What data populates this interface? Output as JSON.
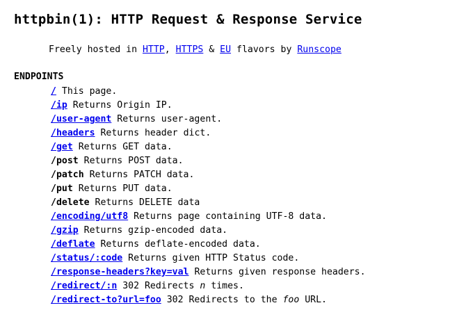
{
  "header": {
    "title": "httpbin(1): HTTP Request & Response Service"
  },
  "tagline": {
    "prefix": "Freely hosted in ",
    "http_link": "HTTP",
    "sep1": ", ",
    "https_link": "HTTPS",
    "sep2": " & ",
    "eu_link": "EU",
    "middle": " flavors by ",
    "runscope_link": "Runscope"
  },
  "endpoints": {
    "heading": "ENDPOINTS",
    "items": [
      {
        "path": "/",
        "desc": " This page.",
        "linked": true
      },
      {
        "path": "/ip",
        "desc": " Returns Origin IP.",
        "linked": true
      },
      {
        "path": "/user-agent",
        "desc": " Returns user-agent.",
        "linked": true
      },
      {
        "path": "/headers",
        "desc": " Returns header dict.",
        "linked": true
      },
      {
        "path": "/get",
        "desc": " Returns GET data.",
        "linked": true
      },
      {
        "path": "/post",
        "desc": " Returns POST data.",
        "linked": false
      },
      {
        "path": "/patch",
        "desc": " Returns PATCH data.",
        "linked": false
      },
      {
        "path": "/put",
        "desc": " Returns PUT data.",
        "linked": false
      },
      {
        "path": "/delete",
        "desc": " Returns DELETE data",
        "linked": false
      },
      {
        "path": "/encoding/utf8",
        "desc": " Returns page containing UTF-8 data.",
        "linked": true
      },
      {
        "path": "/gzip",
        "desc": " Returns gzip-encoded data.",
        "linked": true
      },
      {
        "path": "/deflate",
        "desc": " Returns deflate-encoded data.",
        "linked": true
      },
      {
        "path": "/status/:code",
        "desc": " Returns given HTTP Status code.",
        "linked": true
      },
      {
        "path": "/response-headers?key=val",
        "desc": " Returns given response headers.",
        "linked": true
      },
      {
        "path": "/redirect/:n",
        "desc_pre": " 302 Redirects ",
        "desc_em": "n",
        "desc_post": " times.",
        "linked": true
      },
      {
        "path": "/redirect-to?url=foo",
        "desc_pre": " 302 Redirects to the ",
        "desc_em": "foo",
        "desc_post": " URL.",
        "linked": true
      }
    ]
  }
}
